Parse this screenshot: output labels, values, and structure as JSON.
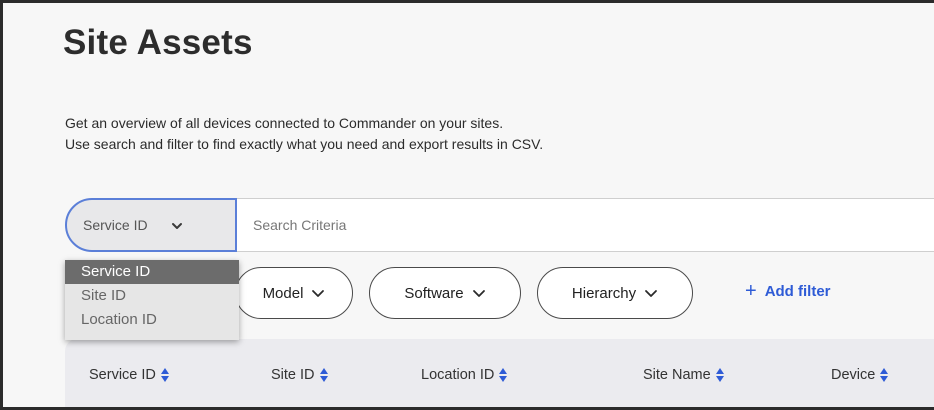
{
  "page": {
    "title": "Site Assets",
    "description_line1": "Get an overview of all devices connected to Commander on your sites.",
    "description_line2": "Use search and filter to find exactly what you need and export results in CSV."
  },
  "search": {
    "selected_field": "Service ID",
    "placeholder": "Search Criteria",
    "value": "",
    "dropdown_options": [
      "Service ID",
      "Site ID",
      "Location ID"
    ],
    "selected_index": 0
  },
  "filters": {
    "model_label": "Model",
    "software_label": "Software",
    "hierarchy_label": "Hierarchy",
    "add_filter_label": "Add filter",
    "add_filter_icon": "+"
  },
  "table": {
    "columns": [
      "Service ID",
      "Site ID",
      "Location ID",
      "Site Name",
      "Device"
    ]
  },
  "colors": {
    "accent": "#2e5bd6",
    "focus_border": "#5b7fd8",
    "selected_option": "#6c6c6c"
  }
}
